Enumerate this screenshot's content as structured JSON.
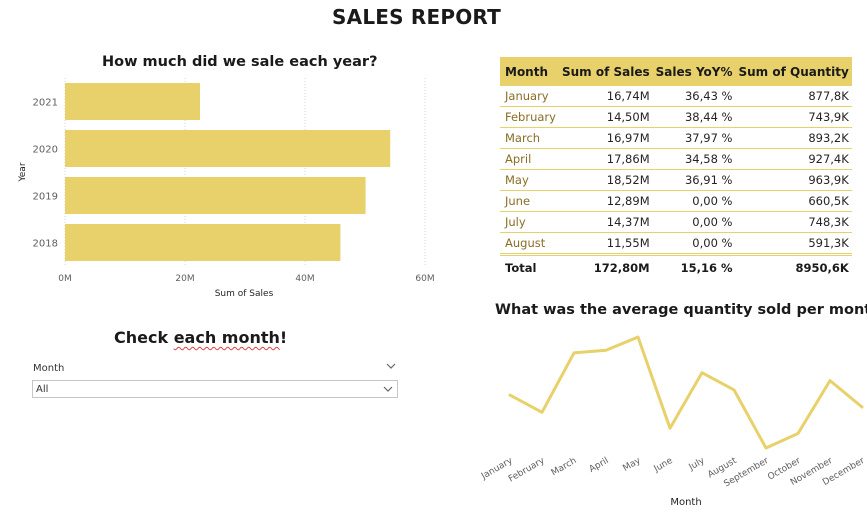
{
  "report": {
    "title": "SALES REPORT"
  },
  "bar_visual": {
    "title": "How much did we sale each year?"
  },
  "slicer": {
    "title_lead": "Check ",
    "title_squiggle": "each month",
    "title_tail": "!",
    "label": "Month",
    "selected": "All"
  },
  "line_visual": {
    "title": "What was the average quantity sold per month?"
  },
  "matrix": {
    "headers": [
      "Month",
      "Sum of Sales",
      "Sales YoY%",
      "Sum of Quantity"
    ],
    "rows": [
      [
        "January",
        "16,74M",
        "36,43 %",
        "877,8K"
      ],
      [
        "February",
        "14,50M",
        "38,44 %",
        "743,9K"
      ],
      [
        "March",
        "16,97M",
        "37,97 %",
        "893,2K"
      ],
      [
        "April",
        "17,86M",
        "34,58 %",
        "927,4K"
      ],
      [
        "May",
        "18,52M",
        "36,91 %",
        "963,9K"
      ],
      [
        "June",
        "12,89M",
        "0,00 %",
        "660,5K"
      ],
      [
        "July",
        "14,37M",
        "0,00 %",
        "748,3K"
      ],
      [
        "August",
        "11,55M",
        "0,00 %",
        "591,3K"
      ]
    ],
    "total": [
      "Total",
      "172,80M",
      "15,16 %",
      "8950,6K"
    ]
  },
  "chart_data": [
    {
      "type": "bar",
      "orientation": "horizontal",
      "categories": [
        "2021",
        "2020",
        "2019",
        "2018"
      ],
      "values": [
        22.5,
        54.2,
        50.1,
        45.9
      ],
      "xlabel": "Sum of Sales",
      "ylabel": "Year",
      "xticks": [
        "0M",
        "20M",
        "40M",
        "60M"
      ],
      "xlim": [
        0,
        60
      ],
      "grid": true,
      "color": "#e8d16b"
    },
    {
      "type": "line",
      "x": [
        "January",
        "February",
        "March",
        "April",
        "May",
        "June",
        "July",
        "August",
        "September",
        "October",
        "November",
        "December"
      ],
      "y": [
        35.7,
        34.4,
        38.9,
        39.1,
        40.1,
        33.2,
        37.4,
        36.1,
        31.7,
        32.8,
        36.8,
        34.8
      ],
      "xlabel": "Month",
      "ylabel": "",
      "grid": false,
      "color": "#e8d16b"
    }
  ],
  "colors": {
    "accent": "#e8d16b",
    "month_text": "#8a6d24"
  },
  "icons": {
    "slicer_chevron": "chevron-down-icon"
  }
}
